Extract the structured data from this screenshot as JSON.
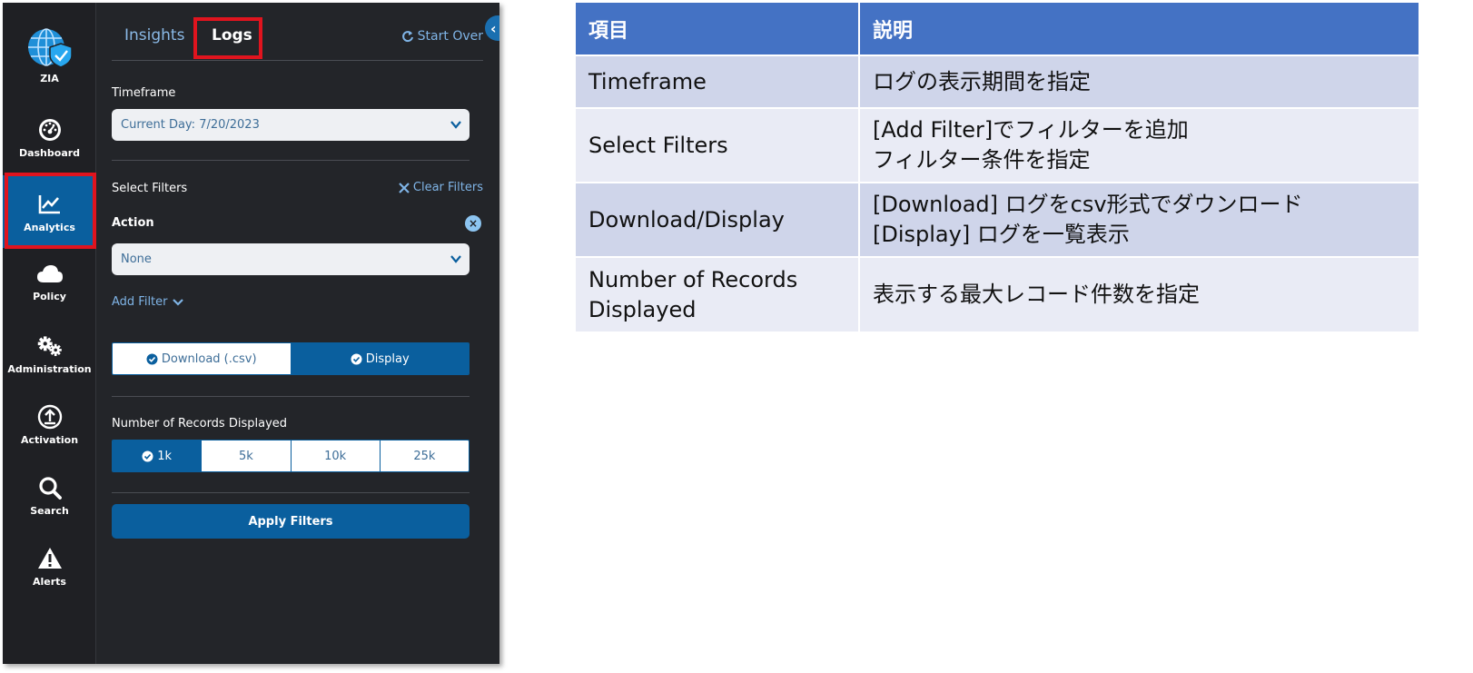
{
  "sidebar": {
    "items": [
      {
        "label": "ZIA",
        "icon": "globe-shield-icon"
      },
      {
        "label": "Dashboard",
        "icon": "gauge-icon"
      },
      {
        "label": "Analytics",
        "icon": "line-chart-icon",
        "active": true
      },
      {
        "label": "Policy",
        "icon": "cloud-icon"
      },
      {
        "label": "Administration",
        "icon": "gears-icon"
      },
      {
        "label": "Activation",
        "icon": "upload-icon"
      },
      {
        "label": "Search",
        "icon": "search-icon"
      },
      {
        "label": "Alerts",
        "icon": "warning-icon"
      }
    ]
  },
  "panel": {
    "tabs": [
      {
        "label": "Insights"
      },
      {
        "label": "Logs",
        "active": true
      }
    ],
    "start_over": "Start Over",
    "timeframe": {
      "label": "Timeframe",
      "value": "Current Day: 7/20/2023"
    },
    "filters": {
      "label": "Select Filters",
      "clear": "Clear Filters",
      "action_label": "Action",
      "action_value": "None",
      "add_filter": "Add Filter"
    },
    "output_mode": {
      "options": [
        {
          "label": "Download (.csv)",
          "selected": false
        },
        {
          "label": "Display",
          "selected": true
        }
      ]
    },
    "records": {
      "label": "Number of Records Displayed",
      "options": [
        {
          "label": "1k",
          "selected": true
        },
        {
          "label": "5k",
          "selected": false
        },
        {
          "label": "10k",
          "selected": false
        },
        {
          "label": "25k",
          "selected": false
        }
      ]
    },
    "apply": "Apply Filters"
  },
  "table": {
    "headers": [
      "項目",
      "説明"
    ],
    "rows": [
      {
        "item": "Timeframe",
        "desc": [
          "ログの表示期間を指定"
        ]
      },
      {
        "item": "Select Filters",
        "desc": [
          "[Add Filter]でフィルターを追加",
          "フィルター条件を指定"
        ]
      },
      {
        "item": "Download/Display",
        "desc": [
          "[Download] ログをcsv形式でダウンロード",
          "[Display] ログを一覧表示"
        ]
      },
      {
        "item": "Number of Records Displayed",
        "desc": [
          "表示する最大レコード件数を指定"
        ]
      }
    ]
  },
  "colors": {
    "accent": "#0a5f9e",
    "highlight": "#e0141e",
    "table_header": "#4472c4"
  }
}
